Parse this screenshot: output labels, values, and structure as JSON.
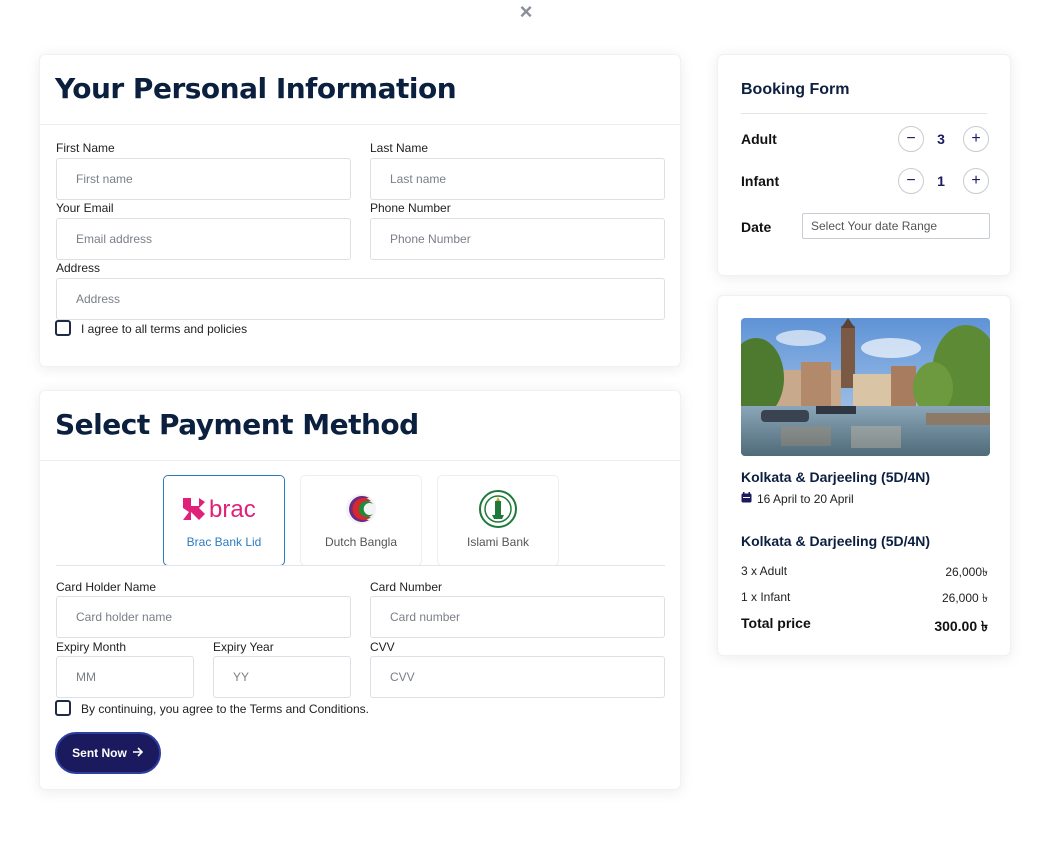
{
  "personal": {
    "title": "Your Personal Information",
    "first_name_label": "First Name",
    "first_name_placeholder": "First name",
    "last_name_label": "Last Name",
    "last_name_placeholder": "Last name",
    "email_label": "Your Email",
    "email_placeholder": "Email address",
    "phone_label": "Phone Number",
    "phone_placeholder": "Phone Number",
    "address_label": "Address",
    "address_placeholder": "Address",
    "agree_text": "I agree to all terms and policies"
  },
  "payment": {
    "title": "Select Payment Method",
    "banks": [
      {
        "name": "Brac Bank Lid",
        "logo_text": "brac",
        "selected": true
      },
      {
        "name": "Dutch Bangla",
        "selected": false
      },
      {
        "name": "Islami Bank",
        "selected": false
      }
    ],
    "card_holder_label": "Card Holder Name",
    "card_holder_placeholder": "Card holder name",
    "card_number_label": "Card Number",
    "card_number_placeholder": "Card number",
    "expiry_month_label": "Expiry Month",
    "expiry_month_placeholder": "MM",
    "expiry_year_label": "Expiry Year",
    "expiry_year_placeholder": "YY",
    "cvv_label": "CVV",
    "cvv_placeholder": "CVV",
    "terms_text": "By continuing, you agree to the Terms and Conditions.",
    "submit_label": "Sent Now"
  },
  "booking": {
    "title": "Booking Form",
    "adult_label": "Adult",
    "adult_count": "3",
    "infant_label": "Infant",
    "infant_count": "1",
    "date_label": "Date",
    "date_placeholder": "Select Your date Range",
    "minus": "−",
    "plus": "+"
  },
  "summary": {
    "trip_title": "Kolkata & Darjeeling (5D/4N)",
    "dates": "16 April to 20 April",
    "trip_title_2": "Kolkata & Darjeeling (5D/4N)",
    "lines": [
      {
        "label": "3 x Adult",
        "value": "26,000৳"
      },
      {
        "label": "1 x Infant",
        "value": "26,000 ৳"
      }
    ],
    "total_label": "Total price",
    "total_value": "300.00 ৳"
  },
  "close_icon": "×",
  "colors": {
    "primary": "#1c1a5e",
    "heading": "#0b1f3f",
    "selected_border": "#2d7bc0",
    "brac_pink": "#e0217a"
  }
}
